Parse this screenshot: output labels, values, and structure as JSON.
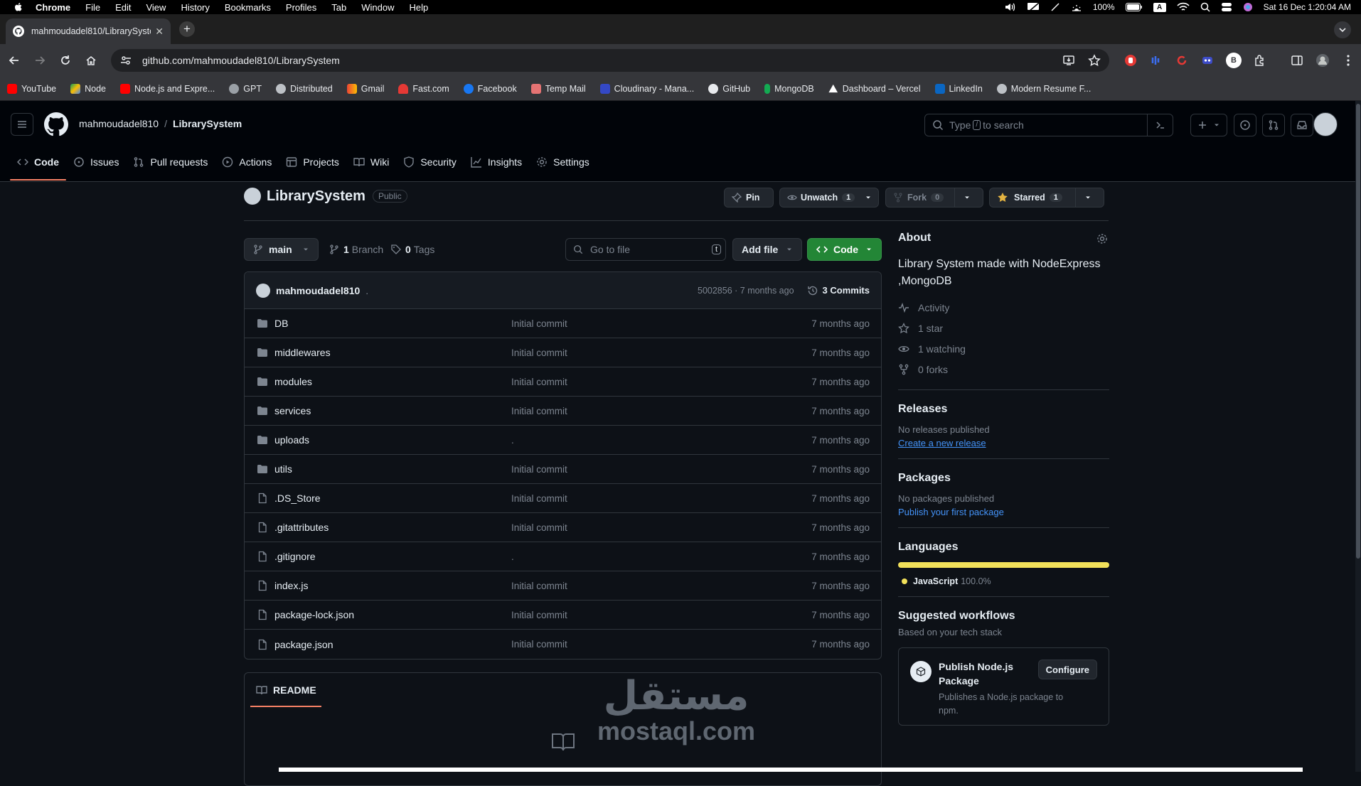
{
  "menubar": {
    "app": "Chrome",
    "items": [
      "File",
      "Edit",
      "View",
      "History",
      "Bookmarks",
      "Profiles",
      "Tab",
      "Window",
      "Help"
    ],
    "battery": "100%",
    "input_source": "A",
    "datetime": "Sat 16 Dec  1:20:04 AM"
  },
  "browser": {
    "tab_title": "mahmoudadel810/LibrarySystem",
    "url": "github.com/mahmoudadel810/LibrarySystem",
    "bookmarks": [
      "YouTube",
      "Node",
      "Node.js and Expre...",
      "GPT",
      "Distributed",
      "Gmail",
      "Fast.com",
      "Facebook",
      "Temp Mail",
      "Cloudinary - Mana...",
      "GitHub",
      "MongoDB",
      "Dashboard – Vercel",
      "LinkedIn",
      "Modern Resume F..."
    ],
    "profile_initial": "B"
  },
  "github": {
    "owner": "mahmoudadel810",
    "separator": "/",
    "repo": "LibrarySystem",
    "search_placeholder_pre": "Type",
    "search_key": "/",
    "search_placeholder_post": "to search",
    "tabs": [
      "Code",
      "Issues",
      "Pull requests",
      "Actions",
      "Projects",
      "Wiki",
      "Security",
      "Insights",
      "Settings"
    ]
  },
  "repo": {
    "name": "LibrarySystem",
    "visibility": "Public",
    "pin_label": "Pin",
    "watch_label": "Unwatch",
    "watch_count": "1",
    "fork_label": "Fork",
    "fork_count": "0",
    "star_label": "Starred",
    "star_count": "1",
    "branch": "main",
    "branch_count": "1",
    "branch_label": "Branch",
    "tag_count": "0",
    "tag_label": "Tags",
    "goto_placeholder": "Go to file",
    "goto_key": "t",
    "add_file_label": "Add file",
    "code_label": "Code"
  },
  "last_commit": {
    "author": "mahmoudadel810",
    "message": ".",
    "hash_time": "5002856 · 7 months ago",
    "commits_label": "3 Commits"
  },
  "files": [
    {
      "name": "DB",
      "type": "dir",
      "message": "Initial commit",
      "date": "7 months ago"
    },
    {
      "name": "middlewares",
      "type": "dir",
      "message": "Initial commit",
      "date": "7 months ago"
    },
    {
      "name": "modules",
      "type": "dir",
      "message": "Initial commit",
      "date": "7 months ago"
    },
    {
      "name": "services",
      "type": "dir",
      "message": "Initial commit",
      "date": "7 months ago"
    },
    {
      "name": "uploads",
      "type": "dir",
      "message": ".",
      "date": "7 months ago"
    },
    {
      "name": "utils",
      "type": "dir",
      "message": "Initial commit",
      "date": "7 months ago"
    },
    {
      "name": ".DS_Store",
      "type": "file",
      "message": "Initial commit",
      "date": "7 months ago"
    },
    {
      "name": ".gitattributes",
      "type": "file",
      "message": "Initial commit",
      "date": "7 months ago"
    },
    {
      "name": ".gitignore",
      "type": "file",
      "message": ".",
      "date": "7 months ago"
    },
    {
      "name": "index.js",
      "type": "file",
      "message": "Initial commit",
      "date": "7 months ago"
    },
    {
      "name": "package-lock.json",
      "type": "file",
      "message": "Initial commit",
      "date": "7 months ago"
    },
    {
      "name": "package.json",
      "type": "file",
      "message": "Initial commit",
      "date": "7 months ago"
    }
  ],
  "readme": {
    "label": "README"
  },
  "watermark": {
    "arabic": "مستقل",
    "latin": "mostaql.com"
  },
  "about": {
    "title": "About",
    "description": "Library System made with NodeExpress ,MongoDB",
    "activity": "Activity",
    "stars": "1 star",
    "watching": "1 watching",
    "forks": "0 forks"
  },
  "releases": {
    "title": "Releases",
    "empty": "No releases published",
    "link": "Create a new release"
  },
  "packages": {
    "title": "Packages",
    "empty": "No packages published",
    "link": "Publish your first package"
  },
  "languages": {
    "title": "Languages",
    "name": "JavaScript",
    "percent": "100.0%",
    "color": "#f1e05a"
  },
  "workflows": {
    "title": "Suggested workflows",
    "subtitle": "Based on your tech stack",
    "card_title": "Publish Node.js Package",
    "card_desc": "Publishes a Node.js package to npm.",
    "configure": "Configure"
  },
  "colors": {
    "accent_underline": "#f78166",
    "code_button": "#238636",
    "link": "#4493f8"
  }
}
